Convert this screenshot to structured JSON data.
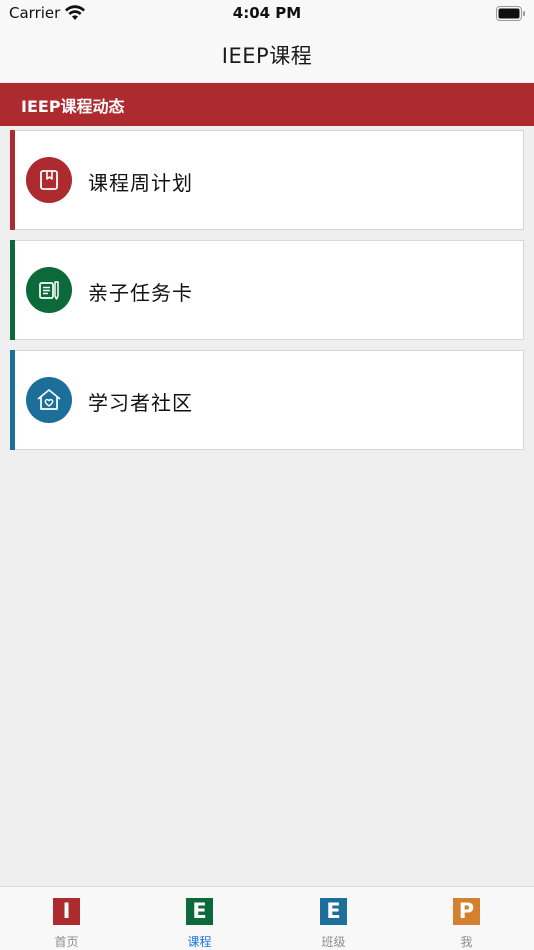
{
  "status_bar": {
    "carrier": "Carrier",
    "time": "4:04 PM"
  },
  "nav": {
    "title": "IEEP课程"
  },
  "section": {
    "title": "IEEP课程动态"
  },
  "cards": [
    {
      "label": "课程周计划",
      "icon": "bookmark-book-icon",
      "color": "#ad2a2f"
    },
    {
      "label": "亲子任务卡",
      "icon": "task-card-icon",
      "color": "#0c6a3a"
    },
    {
      "label": "学习者社区",
      "icon": "house-heart-icon",
      "color": "#1d6f9b"
    }
  ],
  "tabs": [
    {
      "letter": "I",
      "label": "首页",
      "color": "#ad2a2f",
      "active": false
    },
    {
      "letter": "E",
      "label": "课程",
      "color": "#0c6a3a",
      "active": true
    },
    {
      "letter": "E",
      "label": "班级",
      "color": "#1d6f9b",
      "active": false
    },
    {
      "letter": "P",
      "label": "我",
      "color": "#d4812f",
      "active": false
    }
  ]
}
